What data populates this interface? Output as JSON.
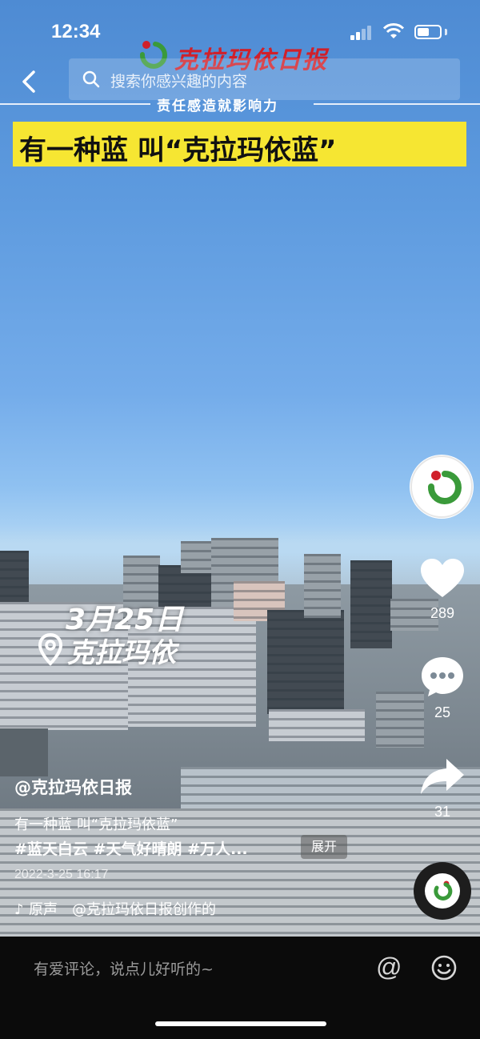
{
  "status_bar": {
    "time": "12:34",
    "battery_level": 0.55
  },
  "header": {
    "search_placeholder": "搜索你感兴趣的内容",
    "masthead": "克拉玛依日报",
    "slogan": "责任感造就影响力"
  },
  "video": {
    "banner_title": "有一种蓝 叫“克拉玛依蓝”",
    "stamp_date": "3月25日",
    "stamp_location": "克拉玛依"
  },
  "right_rail": {
    "likes": "289",
    "comments": "25",
    "shares": "31"
  },
  "caption": {
    "author": "@克拉玛依日报",
    "description": "有一种蓝 叫“克拉玛依蓝”",
    "hashtags": "#蓝天白云 #天气好晴朗 #万人...",
    "expand_label": "展开",
    "datetime": "2022-3-25 16:17",
    "music": "原声　@克拉玛依日报创作的"
  },
  "bottom_bar": {
    "comment_placeholder": "有爱评论，说点儿好听的~",
    "at_symbol": "@"
  },
  "icons": [
    "back-icon",
    "search-icon",
    "heart-icon",
    "comment-icon",
    "share-icon",
    "location-pin-icon",
    "emoji-icon",
    "music-note-icon"
  ],
  "colors": {
    "banner_yellow": "#f6e632",
    "brand_red": "#d0202a",
    "brand_green": "#3a9a3a"
  }
}
